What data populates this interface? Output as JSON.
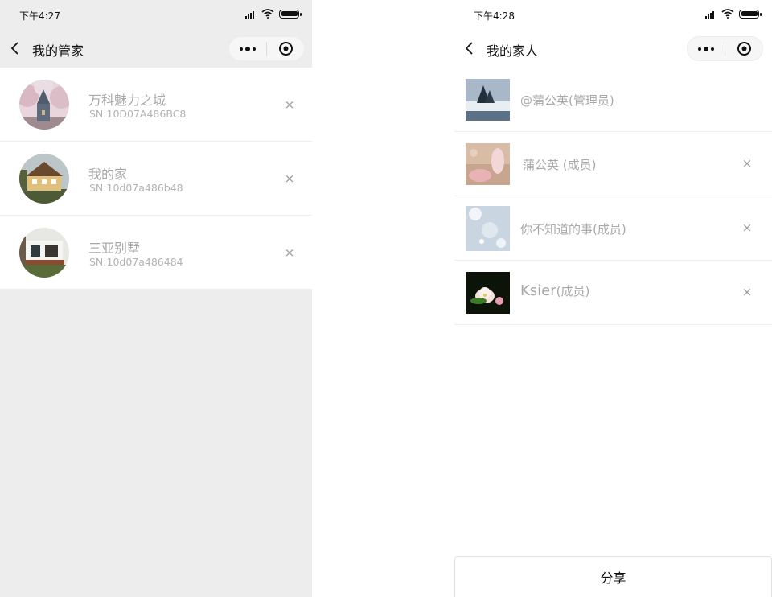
{
  "left_screen": {
    "status": {
      "time": "下午4:27"
    },
    "nav": {
      "title": "我的管家"
    },
    "items": [
      {
        "name": "万科魅力之城",
        "sn": "SN:10D07A486BC8"
      },
      {
        "name": "我的家",
        "sn": "SN:10d07a486b48"
      },
      {
        "name": "三亚别墅",
        "sn": "SN:10d07a486484"
      }
    ]
  },
  "right_screen": {
    "status": {
      "time": "下午4:28"
    },
    "nav": {
      "title": "我的家人"
    },
    "members": [
      {
        "name": "@蒲公英(管理员)"
      },
      {
        "name": "蒲公英 (成员)"
      },
      {
        "name": "你不知道的事(成员)"
      },
      {
        "name": "Ksier",
        "role": "(成员)"
      }
    ],
    "share_label": "分享"
  },
  "icons": {
    "back": "chevron-left-icon",
    "more": "more-dots-icon",
    "target": "target-icon",
    "remove": "close-icon",
    "remove_glyph": "×"
  }
}
